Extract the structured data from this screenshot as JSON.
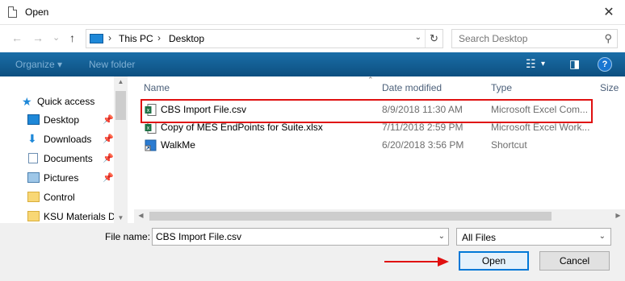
{
  "window": {
    "title": "Open",
    "close_glyph": "✕"
  },
  "nav_buttons": {
    "back": "←",
    "forward": "→",
    "recent": "⌄",
    "up": "↑"
  },
  "address": {
    "crumbs": [
      "This PC",
      "Desktop"
    ],
    "separator": "›",
    "dropdown": "⌄",
    "refresh": "↻"
  },
  "search": {
    "placeholder": "Search Desktop"
  },
  "toolbar": {
    "organize": "Organize ▾",
    "new_folder": "New folder",
    "help": "?"
  },
  "sidebar": {
    "items": [
      {
        "label": "Quick access",
        "icon": "star-icon",
        "pinned": false
      },
      {
        "label": "Desktop",
        "icon": "desktop-folder-icon",
        "pinned": true
      },
      {
        "label": "Downloads",
        "icon": "downloads-folder-icon",
        "pinned": true
      },
      {
        "label": "Documents",
        "icon": "documents-folder-icon",
        "pinned": true
      },
      {
        "label": "Pictures",
        "icon": "pictures-folder-icon",
        "pinned": true
      },
      {
        "label": "Control",
        "icon": "folder-icon",
        "pinned": false
      },
      {
        "label": "KSU Materials De",
        "icon": "folder-icon",
        "pinned": false
      }
    ]
  },
  "columns": {
    "name": "Name",
    "date": "Date modified",
    "type": "Type",
    "size": "Size",
    "sort_indicator": "⌃"
  },
  "files": [
    {
      "name": "CBS Import File.csv",
      "date": "8/9/2018 11:30 AM",
      "type": "Microsoft Excel Com...",
      "icon": "excel-csv-icon"
    },
    {
      "name": "Copy of MES EndPoints for Suite.xlsx",
      "date": "7/11/2018 2:59 PM",
      "type": "Microsoft Excel Work...",
      "icon": "excel-xlsx-icon"
    },
    {
      "name": "WalkMe",
      "date": "6/20/2018 3:56 PM",
      "type": "Shortcut",
      "icon": "shortcut-icon"
    }
  ],
  "footer": {
    "file_name_label": "File name:",
    "file_name_value": "CBS Import File.csv",
    "filter_value": "All Files",
    "open_label": "Open",
    "cancel_label": "Cancel"
  },
  "colors": {
    "highlight": "#e01010",
    "toolbar": "#0d4f80",
    "accent": "#0078d7"
  }
}
